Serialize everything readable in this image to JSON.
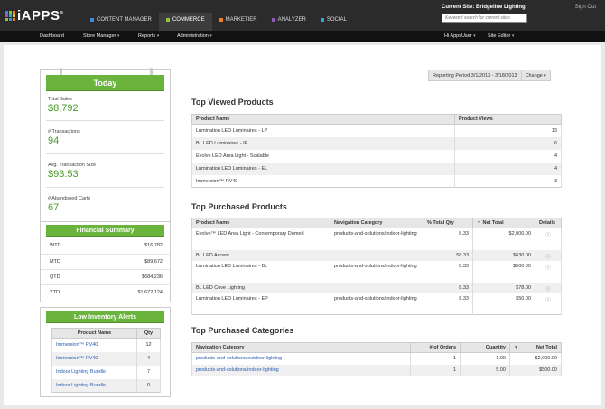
{
  "app": {
    "logo": "iAPPS",
    "logo_reg": "®",
    "current_site": "Current Site: Bridgeline Lighting",
    "sign_out": "Sign Out",
    "search_placeholder": "Keyword search for current sites"
  },
  "product_nav": [
    {
      "label": "CONTENT MANAGER",
      "color": "#3a8fd6",
      "active": false
    },
    {
      "label": "COMMERCE",
      "color": "#8cc63f",
      "active": true
    },
    {
      "label": "MARKETIER",
      "color": "#f0821e",
      "active": false
    },
    {
      "label": "ANALYZER",
      "color": "#8e5bb5",
      "active": false
    },
    {
      "label": "SOCIAL",
      "color": "#2aa8d8",
      "active": false
    }
  ],
  "sub_nav": {
    "dashboard": "Dashboard",
    "store_manager": "Store Manager",
    "reports": "Reports",
    "administration": "Administration",
    "user": "Hi AppsUser",
    "site_editor": "Site Editor",
    "caret": "▾"
  },
  "today": {
    "title": "Today",
    "total_sales_label": "Total Sales",
    "total_sales": "$8,792",
    "transactions_label": "# Transactions",
    "transactions": "94",
    "avg_label": "Avg. Transaction Size",
    "avg": "$93.53",
    "abandoned_label": "# Abandoned Carts",
    "abandoned": "67"
  },
  "financial": {
    "title": "Financial Summary",
    "rows": [
      {
        "label": "WTD",
        "value": "$16,782"
      },
      {
        "label": "MTD",
        "value": "$89,672"
      },
      {
        "label": "QTD",
        "value": "$684,236"
      },
      {
        "label": "YTD",
        "value": "$1,672,124"
      }
    ]
  },
  "low_inventory": {
    "title": "Low Inventory Alerts",
    "col_product": "Product Name",
    "col_qty": "Qty",
    "rows": [
      {
        "name": "Immersion™ RV40",
        "qty": "12"
      },
      {
        "name": "Immersion™ RV40",
        "qty": "4"
      },
      {
        "name": "Indoor Lighting Bundle",
        "qty": "7"
      },
      {
        "name": "Indoor Lighting Bundle",
        "qty": "0"
      }
    ]
  },
  "period": {
    "label": "Reporting Period 3/1/2013 - 3/18/2013",
    "change": "Change",
    "caret": "▾"
  },
  "top_viewed": {
    "title": "Top Viewed Products",
    "col_product": "Product Name",
    "col_views": "Product Views",
    "rows": [
      {
        "name": "Lumination LED Luminaires - LP",
        "views": "13"
      },
      {
        "name": "BL LED Luminaires - IP",
        "views": "6"
      },
      {
        "name": "Evolve LED Area Light - Scalable",
        "views": "4"
      },
      {
        "name": "Lumination LED Luminaires - EL",
        "views": "4"
      },
      {
        "name": "Immersion™ RV40",
        "views": "3"
      }
    ]
  },
  "top_purchased": {
    "title": "Top Purchased Products",
    "col_product": "Product Name",
    "col_nav": "Navigation Category",
    "col_pct": "% Total Qty",
    "col_net": "Net Total",
    "col_details": "Details",
    "rows": [
      {
        "name": "Evolve™ LED Area Light - Contemporary Domed",
        "nav": "products-and-solutions/indoor-lighting",
        "pct": "8.33",
        "net": "$2,000.00",
        "details": "Ⓘ"
      },
      {
        "name": "BL LED Accent",
        "nav": "",
        "pct": "58.33",
        "net": "$630.00",
        "details": "Ⓘ"
      },
      {
        "name": "Lumination LED Luminaires - BL",
        "nav": "products-and-solutions/indoor-lighting",
        "pct": "8.33",
        "net": "$500.00",
        "details": "Ⓘ"
      },
      {
        "name": "BL LED Cove Lighting",
        "nav": "",
        "pct": "8.33",
        "net": "$78.00",
        "details": "Ⓘ"
      },
      {
        "name": "Lumination LED Luminaires - EP",
        "nav": "products-and-solutions/indoor-lighting",
        "pct": "8.33",
        "net": "$50.00",
        "details": "Ⓘ"
      }
    ]
  },
  "top_categories": {
    "title": "Top Purchased Categories",
    "col_nav": "Navigation Category",
    "col_orders": "# of Orders",
    "col_qty": "Quantity",
    "col_net": "Net Total",
    "rows": [
      {
        "nav": "products-and-solutions/outdoor-lighting",
        "orders": "1",
        "qty": "1.00",
        "net": "$2,000.00"
      },
      {
        "nav": "products-and-solutions/indoor-lighting",
        "orders": "1",
        "qty": "5.00",
        "net": "$500.00"
      }
    ]
  },
  "sort_arrow": "▼"
}
